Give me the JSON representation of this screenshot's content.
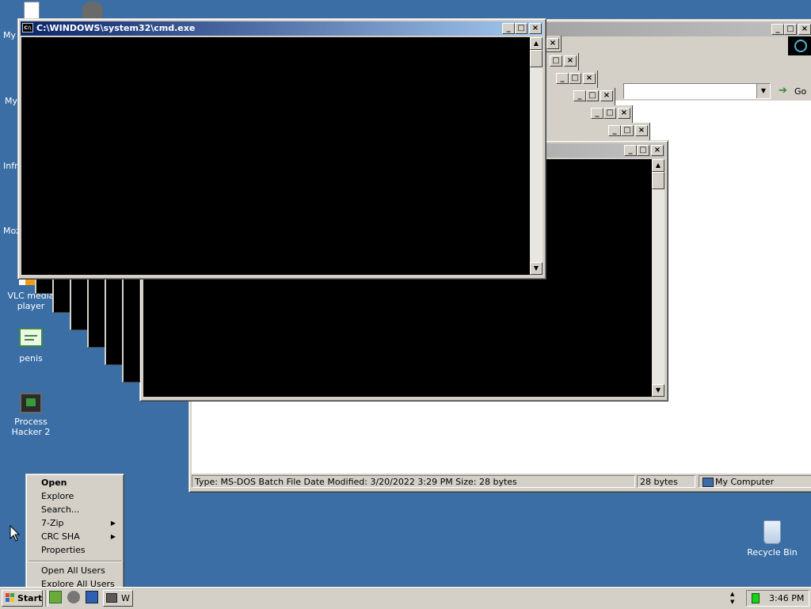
{
  "desktop": {
    "icons": [
      {
        "label": "VLC media player"
      },
      {
        "label": "penis"
      },
      {
        "label": "Process Hacker 2"
      },
      {
        "label": "Recycle Bin"
      }
    ],
    "partial_labels": [
      "My",
      "My",
      "Infr",
      "Moz"
    ]
  },
  "cmd_window": {
    "title": "C:\\WINDOWS\\system32\\cmd.exe",
    "icon_text": "C:\\"
  },
  "explorer": {
    "go_label": "Go",
    "status": {
      "info": "Type: MS-DOS Batch File Date Modified: 3/20/2022 3:29 PM Size: 28 bytes",
      "size": "28 bytes",
      "zone": "My Computer"
    }
  },
  "context_menu": {
    "items": [
      {
        "label": "Open",
        "bold": true
      },
      {
        "label": "Explore"
      },
      {
        "label": "Search..."
      },
      {
        "label": "7-Zip",
        "submenu": true
      },
      {
        "label": "CRC SHA",
        "submenu": true
      },
      {
        "label": "Properties"
      },
      {
        "label": "Open All Users"
      },
      {
        "label": "Explore All Users"
      }
    ]
  },
  "taskbar": {
    "start_label": "Start",
    "task_label": "W",
    "clock": "3:46 PM"
  },
  "colors": {
    "desktop": "#3a6ea5",
    "active_title": "#0a246a",
    "face": "#d4d0c8"
  }
}
